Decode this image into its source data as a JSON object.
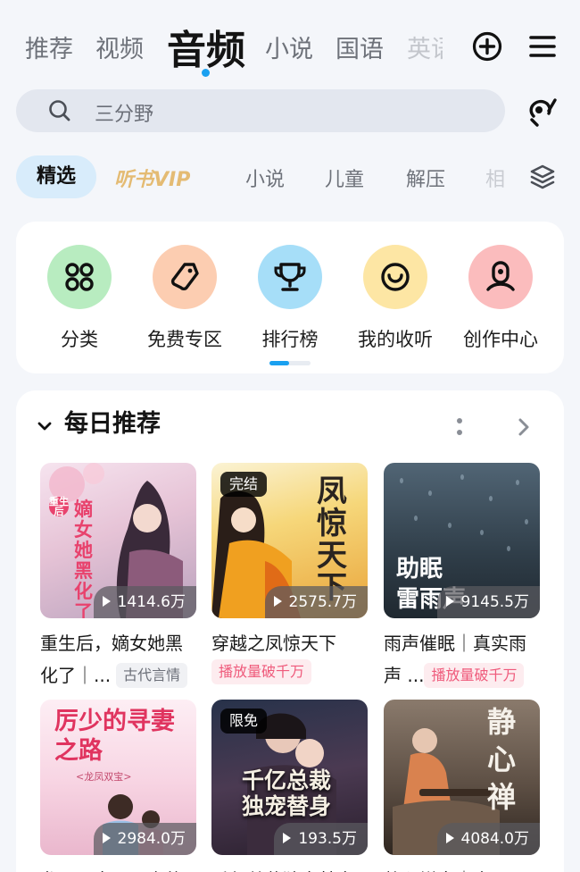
{
  "top_tabs": [
    {
      "label": "推荐"
    },
    {
      "label": "视频"
    },
    {
      "label": "音频"
    },
    {
      "label": "小说"
    },
    {
      "label": "国语"
    },
    {
      "label": "英语"
    }
  ],
  "active_top_tab": "音频",
  "accent_color": "#1aa0f0",
  "search": {
    "placeholder": "三分野"
  },
  "categories": [
    {
      "label": "精选"
    },
    {
      "label": "听书VIP"
    },
    {
      "label": "小说"
    },
    {
      "label": "儿童"
    },
    {
      "label": "解压"
    },
    {
      "label": "相"
    }
  ],
  "active_category": "精选",
  "shortcuts": [
    {
      "label": "分类",
      "icon": "grid-icon",
      "color": "#b8ecc0"
    },
    {
      "label": "免费专区",
      "icon": "tag-icon",
      "color": "#fccdb1"
    },
    {
      "label": "排行榜",
      "icon": "trophy-icon",
      "color": "#a6def8"
    },
    {
      "label": "我的收听",
      "icon": "smile-icon",
      "color": "#fde6a4"
    },
    {
      "label": "创作中心",
      "icon": "mic-person-icon",
      "color": "#fbbcbd"
    }
  ],
  "daily": {
    "title": "每日推荐",
    "items": [
      {
        "title": "重生后，嫡女她黑化了｜...",
        "line1": "重生后，嫡女她黑",
        "line2": "化了｜...",
        "tag": "古代言情",
        "plays": "1414.6万",
        "badge": "",
        "cover_text": "嫡女她黑化了",
        "cover_small": "重生后"
      },
      {
        "title": "穿越之凤惊天下",
        "line1": "穿越之凤惊天下",
        "line2": "",
        "tag": "播放量破千万",
        "plays": "2575.7万",
        "badge": "完结",
        "cover_text": "凤惊天下"
      },
      {
        "title": "雨声催眠｜真实雨声...",
        "line1": "雨声催眠｜真实雨",
        "line2": "声 ...",
        "tag": "播放量破千万",
        "plays": "9145.5万",
        "badge": "",
        "cover_text": "助眠",
        "cover_text2": "雷雨声"
      },
      {
        "title": "龙凤双宝：厉少的寻妻之路",
        "line1": "龙凤双宝：厉少的",
        "line2": "",
        "tag": "",
        "plays": "2984.0万",
        "badge": "",
        "cover_text": "厉少的寻妻之路",
        "cover_small": "<龙凤双宝>"
      },
      {
        "title": "千亿总裁独宠替身",
        "line1": "千亿总裁独宠替身",
        "line2": "",
        "tag": "",
        "plays": "193.5万",
        "badge": "限免",
        "cover_text": "千亿总裁独宠替身"
      },
      {
        "title": "静心禅音｜古琴",
        "line1": "静心禅音｜古琴",
        "line2": "",
        "tag": "",
        "plays": "4084.0万",
        "badge": "",
        "cover_text": "静心禅"
      }
    ]
  }
}
